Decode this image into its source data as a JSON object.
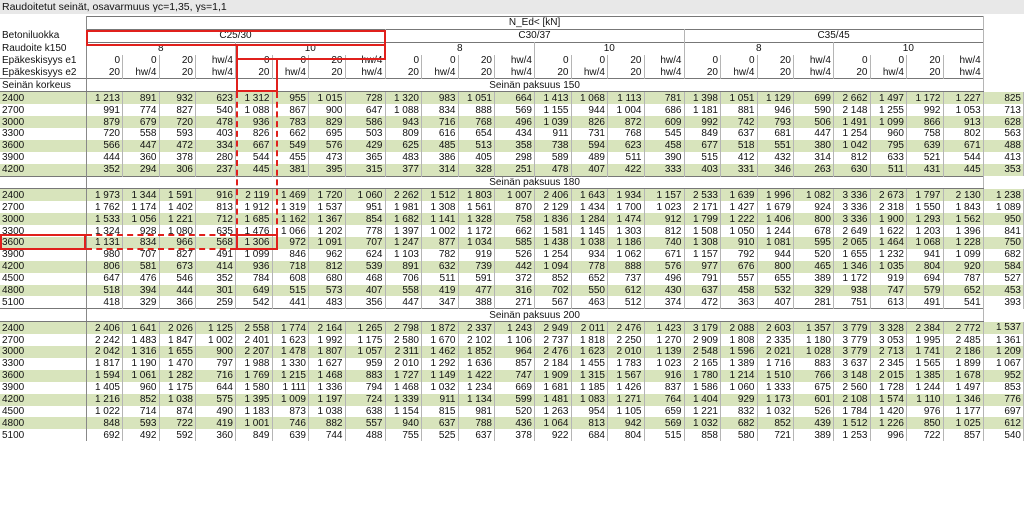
{
  "title": "Raudoitetut seinät, osavarmuus γc=1,35, γs=1,1",
  "header": {
    "ned": "N_Ed< [kN]",
    "betoniluokka": "Betoniluokka",
    "raudoite": "Raudoite k150",
    "e1": "Epäkeskisyys e1",
    "e2": "Epäkeskisyys e2",
    "classes": [
      "C25/30",
      "C30/37",
      "C35/45"
    ],
    "rebar": [
      "8",
      "10"
    ],
    "e1_vals": [
      "0",
      "0",
      "20",
      "hw/4"
    ],
    "e2_vals": [
      "20",
      "hw/4",
      "20",
      "hw/4"
    ]
  },
  "seinan_korkeus": "Seinän korkeus",
  "sections": [
    {
      "title": "Seinän paksuus 150",
      "rows": [
        [
          "2400",
          "1 213",
          "891",
          "932",
          "623",
          "1 312",
          "955",
          "1 015",
          "728",
          "1 320",
          "983",
          "1 051",
          "664",
          "1 413",
          "1 068",
          "1 113",
          "781",
          "1 398",
          "1 051",
          "1 129",
          "699",
          "2 662",
          "1 497",
          "1 172",
          "1 227",
          "825"
        ],
        [
          "2700",
          "991",
          "774",
          "827",
          "540",
          "1 088",
          "867",
          "900",
          "647",
          "1 088",
          "834",
          "888",
          "569",
          "1 155",
          "944",
          "1 004",
          "686",
          "1 181",
          "881",
          "946",
          "590",
          "2 148",
          "1 255",
          "992",
          "1 053",
          "713"
        ],
        [
          "3000",
          "879",
          "679",
          "720",
          "478",
          "936",
          "783",
          "829",
          "586",
          "943",
          "716",
          "768",
          "496",
          "1 039",
          "826",
          "872",
          "609",
          "992",
          "742",
          "793",
          "506",
          "1 491",
          "1 099",
          "866",
          "913",
          "628"
        ],
        [
          "3300",
          "720",
          "558",
          "593",
          "403",
          "826",
          "662",
          "695",
          "503",
          "809",
          "616",
          "654",
          "434",
          "911",
          "731",
          "768",
          "545",
          "849",
          "637",
          "681",
          "447",
          "1 254",
          "960",
          "758",
          "802",
          "563"
        ],
        [
          "3600",
          "566",
          "447",
          "472",
          "334",
          "667",
          "549",
          "576",
          "429",
          "625",
          "485",
          "513",
          "358",
          "738",
          "594",
          "623",
          "458",
          "677",
          "518",
          "551",
          "380",
          "1 042",
          "795",
          "639",
          "671",
          "488"
        ],
        [
          "3900",
          "444",
          "360",
          "378",
          "280",
          "544",
          "455",
          "473",
          "365",
          "483",
          "386",
          "405",
          "298",
          "589",
          "489",
          "511",
          "390",
          "515",
          "412",
          "432",
          "314",
          "812",
          "633",
          "521",
          "544",
          "413"
        ],
        [
          "4200",
          "352",
          "294",
          "306",
          "237",
          "445",
          "381",
          "395",
          "315",
          "377",
          "314",
          "328",
          "251",
          "478",
          "407",
          "422",
          "333",
          "403",
          "331",
          "346",
          "263",
          "630",
          "511",
          "431",
          "445",
          "353"
        ]
      ]
    },
    {
      "title": "Seinän paksuus 180",
      "rows": [
        [
          "2400",
          "1 973",
          "1 344",
          "1 591",
          "916",
          "2 119",
          "1 469",
          "1 720",
          "1 060",
          "2 262",
          "1 512",
          "1 803",
          "1 007",
          "2 406",
          "1 643",
          "1 934",
          "1 157",
          "2 533",
          "1 639",
          "1 996",
          "1 082",
          "3 336",
          "2 673",
          "1 797",
          "2 130",
          "1 238"
        ],
        [
          "2700",
          "1 762",
          "1 174",
          "1 402",
          "813",
          "1 912",
          "1 319",
          "1 537",
          "951",
          "1 981",
          "1 308",
          "1 561",
          "870",
          "2 129",
          "1 434",
          "1 700",
          "1 023",
          "2 171",
          "1 427",
          "1 679",
          "924",
          "3 336",
          "2 318",
          "1 550",
          "1 843",
          "1 089"
        ],
        [
          "3000",
          "1 533",
          "1 056",
          "1 221",
          "712",
          "1 685",
          "1 162",
          "1 367",
          "854",
          "1 682",
          "1 141",
          "1 328",
          "758",
          "1 836",
          "1 284",
          "1 474",
          "912",
          "1 799",
          "1 222",
          "1 406",
          "800",
          "3 336",
          "1 900",
          "1 293",
          "1 562",
          "950"
        ],
        [
          "3300",
          "1 324",
          "928",
          "1 080",
          "635",
          "1 476",
          "1 066",
          "1 202",
          "778",
          "1 397",
          "1 002",
          "1 172",
          "662",
          "1 581",
          "1 145",
          "1 303",
          "812",
          "1 508",
          "1 050",
          "1 244",
          "678",
          "2 649",
          "1 622",
          "1 203",
          "1 396",
          "841"
        ],
        [
          "3600",
          "1 131",
          "834",
          "966",
          "568",
          "1 306",
          "972",
          "1 091",
          "707",
          "1 247",
          "877",
          "1 034",
          "585",
          "1 438",
          "1 038",
          "1 186",
          "740",
          "1 308",
          "910",
          "1 081",
          "595",
          "2 065",
          "1 464",
          "1 068",
          "1 228",
          "750"
        ],
        [
          "3900",
          "980",
          "707",
          "827",
          "491",
          "1 099",
          "846",
          "962",
          "624",
          "1 103",
          "782",
          "919",
          "526",
          "1 254",
          "934",
          "1 062",
          "671",
          "1 157",
          "792",
          "944",
          "520",
          "1 655",
          "1 232",
          "941",
          "1 099",
          "682"
        ],
        [
          "4200",
          "806",
          "581",
          "673",
          "414",
          "936",
          "718",
          "812",
          "539",
          "891",
          "632",
          "739",
          "442",
          "1 094",
          "778",
          "888",
          "576",
          "977",
          "676",
          "800",
          "465",
          "1 346",
          "1 035",
          "804",
          "920",
          "584"
        ],
        [
          "4500",
          "647",
          "476",
          "546",
          "352",
          "784",
          "608",
          "680",
          "468",
          "706",
          "511",
          "591",
          "372",
          "852",
          "652",
          "737",
          "496",
          "791",
          "557",
          "655",
          "389",
          "1 172",
          "919",
          "694",
          "787",
          "527"
        ],
        [
          "4800",
          "518",
          "394",
          "444",
          "301",
          "649",
          "515",
          "573",
          "407",
          "558",
          "419",
          "477",
          "316",
          "702",
          "550",
          "612",
          "430",
          "637",
          "458",
          "532",
          "329",
          "938",
          "747",
          "579",
          "652",
          "453"
        ],
        [
          "5100",
          "418",
          "329",
          "366",
          "259",
          "542",
          "441",
          "483",
          "356",
          "447",
          "347",
          "388",
          "271",
          "567",
          "463",
          "512",
          "374",
          "472",
          "363",
          "407",
          "281",
          "751",
          "613",
          "491",
          "541",
          "393"
        ]
      ]
    },
    {
      "title": "Seinän paksuus 200",
      "rows": [
        [
          "2400",
          "2 406",
          "1 641",
          "2 026",
          "1 125",
          "2 558",
          "1 774",
          "2 164",
          "1 265",
          "2 798",
          "1 872",
          "2 337",
          "1 243",
          "2 949",
          "2 011",
          "2 476",
          "1 423",
          "3 179",
          "2 088",
          "2 603",
          "1 357",
          "3 779",
          "3 328",
          "2 384",
          "2 772",
          "1 537"
        ],
        [
          "2700",
          "2 242",
          "1 483",
          "1 847",
          "1 002",
          "2 401",
          "1 623",
          "1 992",
          "1 175",
          "2 580",
          "1 670",
          "2 102",
          "1 106",
          "2 737",
          "1 818",
          "2 250",
          "1 270",
          "2 909",
          "1 808",
          "2 335",
          "1 180",
          "3 779",
          "3 053",
          "1 995",
          "2 485",
          "1 361"
        ],
        [
          "3000",
          "2 042",
          "1 316",
          "1 655",
          "900",
          "2 207",
          "1 478",
          "1 807",
          "1 057",
          "2 311",
          "1 462",
          "1 852",
          "964",
          "2 476",
          "1 623",
          "2 010",
          "1 139",
          "2 548",
          "1 596",
          "2 021",
          "1 028",
          "3 779",
          "2 713",
          "1 741",
          "2 186",
          "1 209"
        ],
        [
          "3300",
          "1 817",
          "1 190",
          "1 470",
          "797",
          "1 988",
          "1 330",
          "1 627",
          "959",
          "2 010",
          "1 292",
          "1 636",
          "857",
          "2 184",
          "1 455",
          "1 783",
          "1 023",
          "2 165",
          "1 389",
          "1 716",
          "883",
          "3 637",
          "2 345",
          "1 565",
          "1 899",
          "1 067"
        ],
        [
          "3600",
          "1 594",
          "1 061",
          "1 282",
          "716",
          "1 769",
          "1 215",
          "1 468",
          "883",
          "1 727",
          "1 149",
          "1 422",
          "747",
          "1 909",
          "1 315",
          "1 567",
          "916",
          "1 780",
          "1 214",
          "1 510",
          "766",
          "3 148",
          "2 015",
          "1 385",
          "1 678",
          "952"
        ],
        [
          "3900",
          "1 405",
          "960",
          "1 175",
          "644",
          "1 580",
          "1 111",
          "1 336",
          "794",
          "1 468",
          "1 032",
          "1 234",
          "669",
          "1 681",
          "1 185",
          "1 426",
          "837",
          "1 586",
          "1 060",
          "1 333",
          "675",
          "2 560",
          "1 728",
          "1 244",
          "1 497",
          "853"
        ],
        [
          "4200",
          "1 216",
          "852",
          "1 038",
          "575",
          "1 395",
          "1 009",
          "1 197",
          "724",
          "1 339",
          "911",
          "1 134",
          "599",
          "1 481",
          "1 083",
          "1 271",
          "764",
          "1 404",
          "929",
          "1 173",
          "601",
          "2 108",
          "1 574",
          "1 110",
          "1 346",
          "776"
        ],
        [
          "4500",
          "1 022",
          "714",
          "874",
          "490",
          "1 183",
          "873",
          "1 038",
          "638",
          "1 154",
          "815",
          "981",
          "520",
          "1 263",
          "954",
          "1 105",
          "659",
          "1 221",
          "832",
          "1 032",
          "526",
          "1 784",
          "1 420",
          "976",
          "1 177",
          "697"
        ],
        [
          "4800",
          "848",
          "593",
          "722",
          "419",
          "1 001",
          "746",
          "882",
          "557",
          "940",
          "637",
          "788",
          "436",
          "1 064",
          "813",
          "942",
          "569",
          "1 032",
          "682",
          "852",
          "439",
          "1 512",
          "1 226",
          "850",
          "1 025",
          "612"
        ],
        [
          "5100",
          "692",
          "492",
          "592",
          "360",
          "849",
          "639",
          "744",
          "488",
          "755",
          "525",
          "637",
          "378",
          "922",
          "684",
          "804",
          "515",
          "858",
          "580",
          "721",
          "389",
          "1 253",
          "996",
          "722",
          "857",
          "540"
        ]
      ]
    }
  ]
}
